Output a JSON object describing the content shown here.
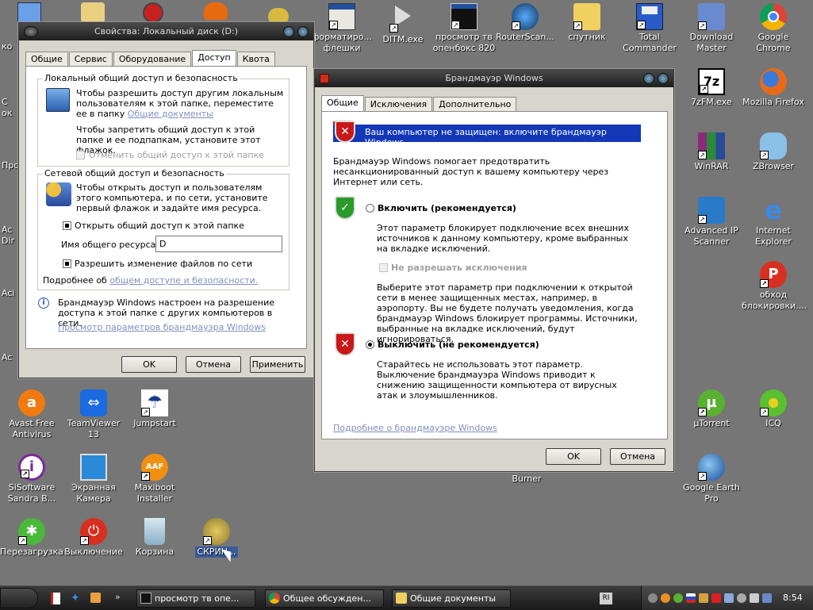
{
  "desktop": {
    "icons_top": [
      {
        "label": "форматиро... флешки"
      },
      {
        "label": "DITM.exe"
      },
      {
        "label": "просмотр тв опенбокс 820"
      },
      {
        "label": "RouterScan..."
      },
      {
        "label": "спутник"
      },
      {
        "label": "Total Commander"
      },
      {
        "label": "Download Master"
      },
      {
        "label": "Google Chrome"
      }
    ],
    "icons_right": [
      {
        "label": "7zFM.exe"
      },
      {
        "label": "Mozilla Firefox"
      },
      {
        "label": "WinRAR"
      },
      {
        "label": "ZBrowser"
      },
      {
        "label": "Advanced IP Scanner"
      },
      {
        "label": "Internet Explorer"
      },
      {
        "label": "обход блокировки...."
      },
      {
        "label": "µTorrent"
      },
      {
        "label": "ICQ"
      },
      {
        "label": "Google Earth Pro"
      }
    ],
    "icons_bottom": [
      {
        "label": "Avast Free Antivirus"
      },
      {
        "label": "TeamViewer 13"
      },
      {
        "label": "Jumpstart"
      },
      {
        "label": "SiSoftware Sandra B..."
      },
      {
        "label": "Экранная Камера"
      },
      {
        "label": "Maxiboot Installer"
      },
      {
        "label": "Перезагрузка"
      },
      {
        "label": "Выключение"
      },
      {
        "label": "Корзина"
      },
      {
        "label": "СКРИН..."
      },
      {
        "label": "Burner"
      }
    ],
    "left_partials": [
      "ко",
      "С ок",
      "Про",
      "Ac Dir",
      "Aci",
      "Ac"
    ]
  },
  "props_window": {
    "title": "Свойства: Локальный диск (D:)",
    "tabs": [
      "Общие",
      "Сервис",
      "Оборудование",
      "Доступ",
      "Квота"
    ],
    "active_tab": "Доступ",
    "local_group": {
      "title": "Локальный общий доступ и безопасность",
      "text1": "Чтобы разрешить доступ другим локальным пользователям к этой папке, переместите ее в папку",
      "link1": "Общие документы",
      "text2": "Чтобы запретить общий доступ к этой папке и ее подпапкам, установите этот флажок.",
      "checkbox_label": "Отменить общий доступ к этой папке"
    },
    "network_group": {
      "title": "Сетевой общий доступ и безопасность",
      "text": "Чтобы открыть доступ и пользователям этого компьютера, и по сети, установите первый флажок и задайте имя ресурса.",
      "share_checkbox": "Открыть общий доступ к этой папке",
      "share_name_label": "Имя общего ресурса:",
      "share_name_value": "D",
      "allow_checkbox": "Разрешить изменение файлов по сети",
      "more_text": "Подробнее об",
      "more_link": "общем доступе и безопасности."
    },
    "firewall_note": "Брандмауэр Windows настроен на разрешение доступа к этой папке с других компьютеров в сети.",
    "firewall_link": "Просмотр параметров брандмауэра Windows",
    "buttons": {
      "ok": "OK",
      "cancel": "Отмена",
      "apply": "Применить"
    }
  },
  "firewall_window": {
    "title": "Брандмауэр Windows",
    "tabs": [
      "Общие",
      "Исключения",
      "Дополнительно"
    ],
    "active_tab": "Общие",
    "banner": "Ваш компьютер не защищен: включите брандмауэр Windows.",
    "intro": "Брандмауэр Windows помогает предотвратить несанкционированный доступ к вашему компьютеру через Интернет или сеть.",
    "on_label": "Включить (рекомендуется)",
    "on_desc": "Этот параметр блокирует подключение всех внешних источников к данному компьютеру, кроме выбранных на вкладке исключений.",
    "no_exceptions": "Не разрешать исключения",
    "no_exc_desc": "Выберите этот параметр при подключении к открытой сети в менее защищенных местах, например, в аэропорту. Вы не будете получать уведомления, когда брандмауэр Windows блокирует программы. Источники, выбранные на вкладке исключений, будут игнорироваться.",
    "off_label": "Выключить (не рекомендуется)",
    "off_desc": "Старайтесь не использовать этот параметр. Выключение брандмауэра Windows приводит к снижению защищенности компьютера от вирусных атак и злоумышленников.",
    "more_link": "Подробнее о брандмауэре Windows",
    "buttons": {
      "ok": "OK",
      "cancel": "Отмена"
    }
  },
  "taskbar": {
    "tasks": [
      "просмотр тв опе...",
      "Общее обсужден...",
      "Общие документы"
    ],
    "lang": "RI",
    "clock": "8:54"
  },
  "colors": {
    "banner": "#1238b8",
    "desktop": "#767676",
    "danger": "#c81818",
    "ok_green": "#2a9a2a"
  }
}
